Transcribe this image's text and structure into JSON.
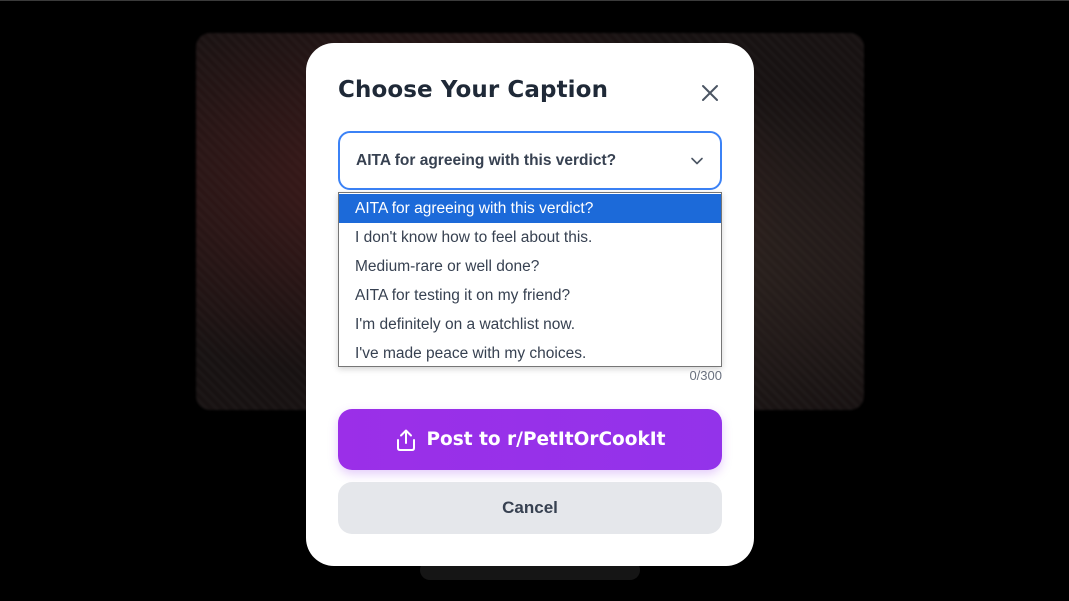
{
  "modal": {
    "title": "Choose Your Caption",
    "close_icon": "close-icon"
  },
  "caption_select": {
    "selected_value": "AITA for agreeing with this verdict?",
    "chevron_icon": "chevron-down-icon",
    "options": [
      "AITA for agreeing with this verdict?",
      "I don't know how to feel about this.",
      "Medium-rare or well done?",
      "AITA for testing it on my friend?",
      "I'm definitely on a watchlist now.",
      "I've made peace with my choices."
    ],
    "selected_index": 0
  },
  "counter": "0/300",
  "actions": {
    "post_label": "Post to r/PetItOrCookIt",
    "post_icon": "share-upload-icon",
    "cancel_label": "Cancel"
  },
  "colors": {
    "accent": "#9333ea",
    "focus_border": "#3b82f6",
    "option_highlight": "#1c6ad9",
    "overlay": "#000000"
  }
}
